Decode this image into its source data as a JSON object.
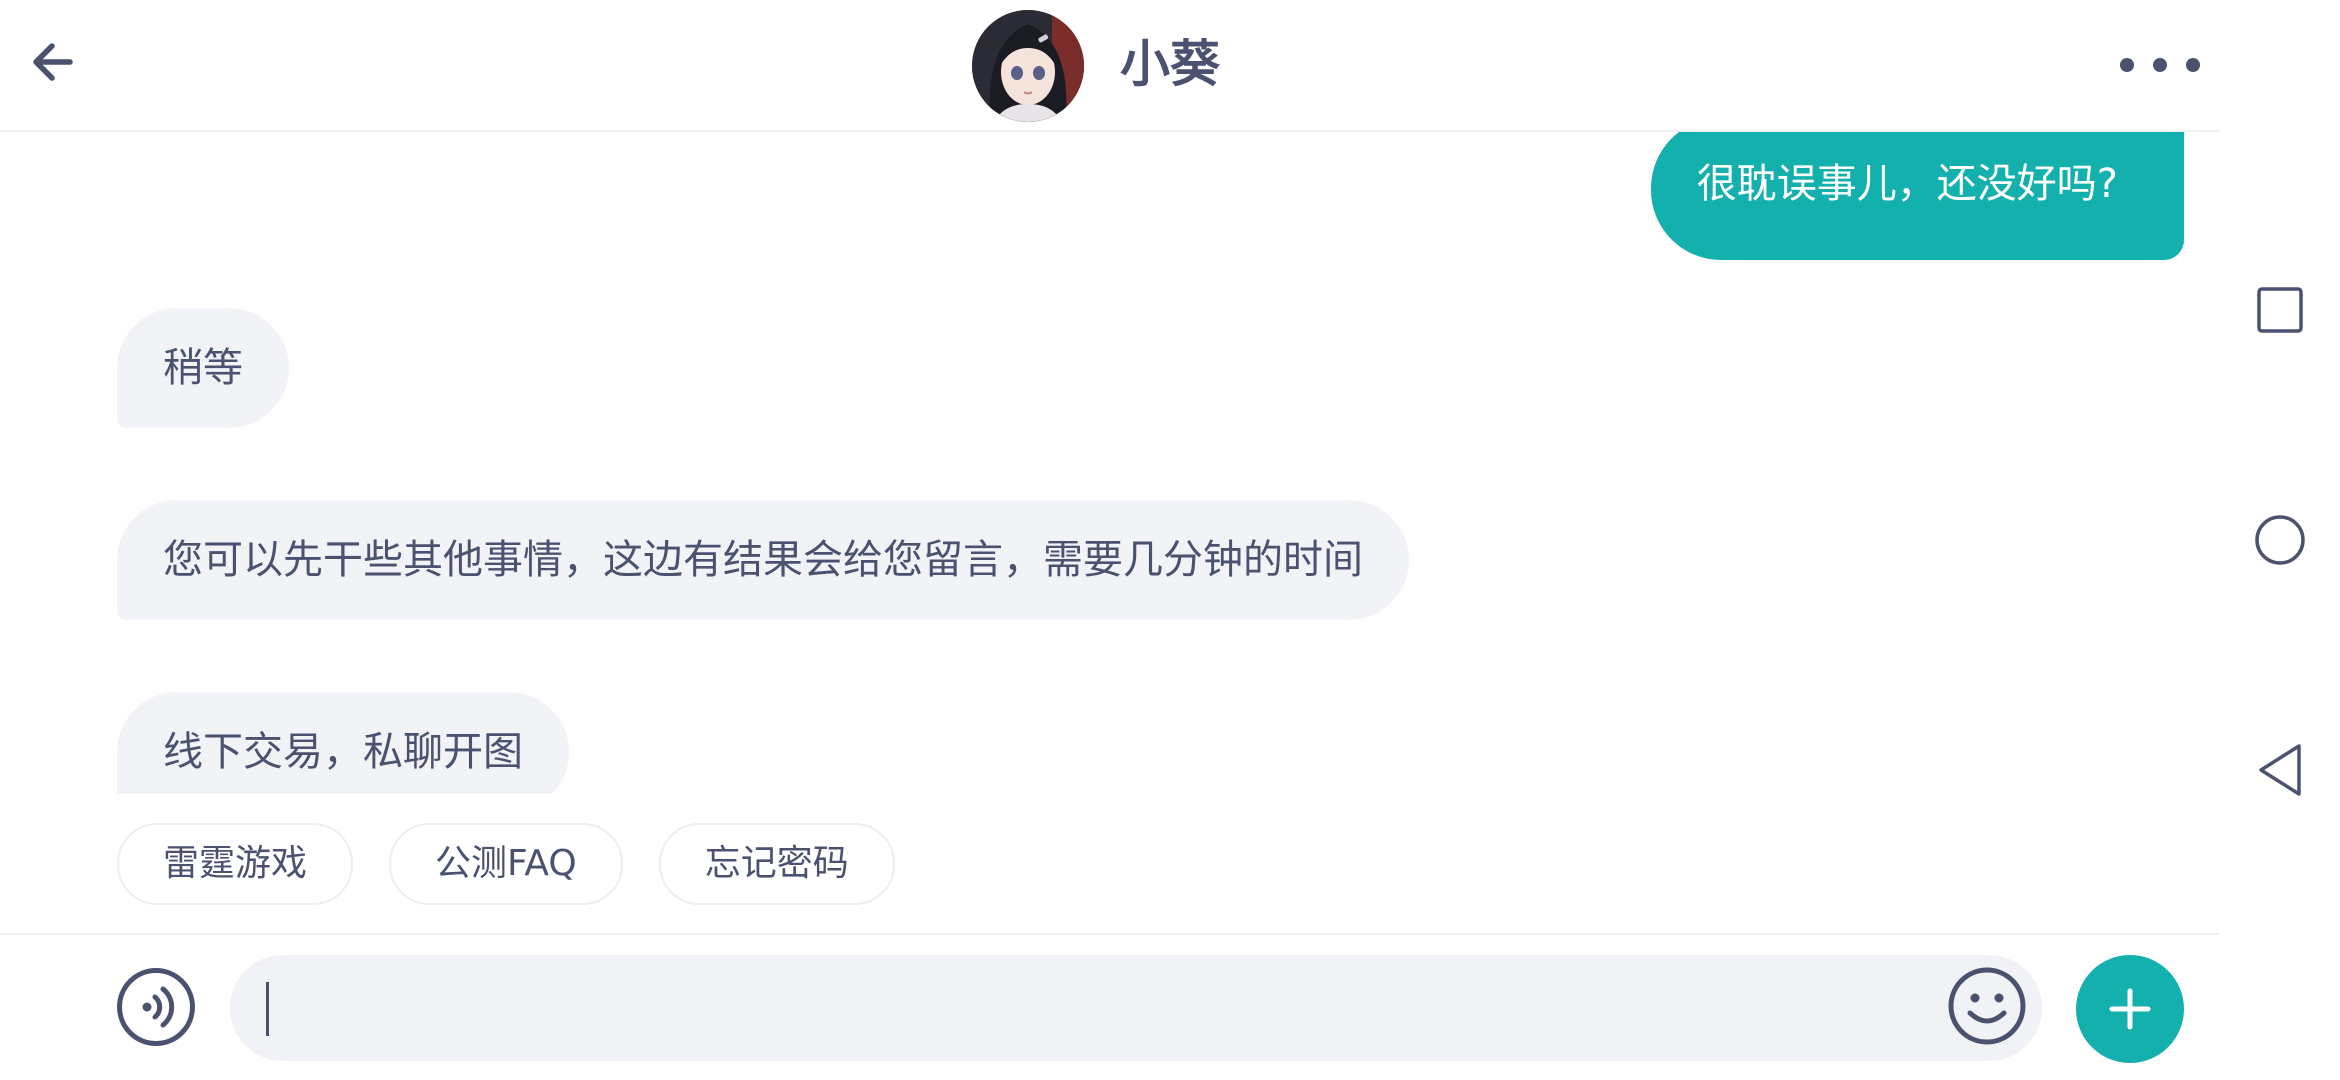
{
  "header": {
    "contact_name": "小葵",
    "icons": {
      "back": "arrow-left-icon",
      "avatar": "contact-avatar",
      "more": "more-dots-icon"
    }
  },
  "messages": [
    {
      "direction": "outgoing",
      "text": "很耽误事儿，还没好吗?"
    },
    {
      "direction": "incoming",
      "text": "稍等"
    },
    {
      "direction": "incoming",
      "text": "您可以先干些其他事情，这边有结果会给您留言，需要几分钟的时间"
    },
    {
      "direction": "incoming",
      "text": "线下交易，私聊开图"
    }
  ],
  "quick_replies": [
    "雷霆游戏",
    "公测FAQ",
    "忘记密码"
  ],
  "input_bar": {
    "value": "",
    "placeholder": "",
    "icons": {
      "voice": "voice-icon",
      "emoji": "emoji-icon",
      "add": "plus-icon"
    }
  },
  "system_nav": {
    "icons": [
      "recents-square-icon",
      "home-circle-icon",
      "back-triangle-icon"
    ]
  },
  "colors": {
    "accent": "#13b0ad",
    "text": "#4a5270",
    "incoming_bubble": "#f1f3f7",
    "input_bg": "#f0f2f6"
  }
}
